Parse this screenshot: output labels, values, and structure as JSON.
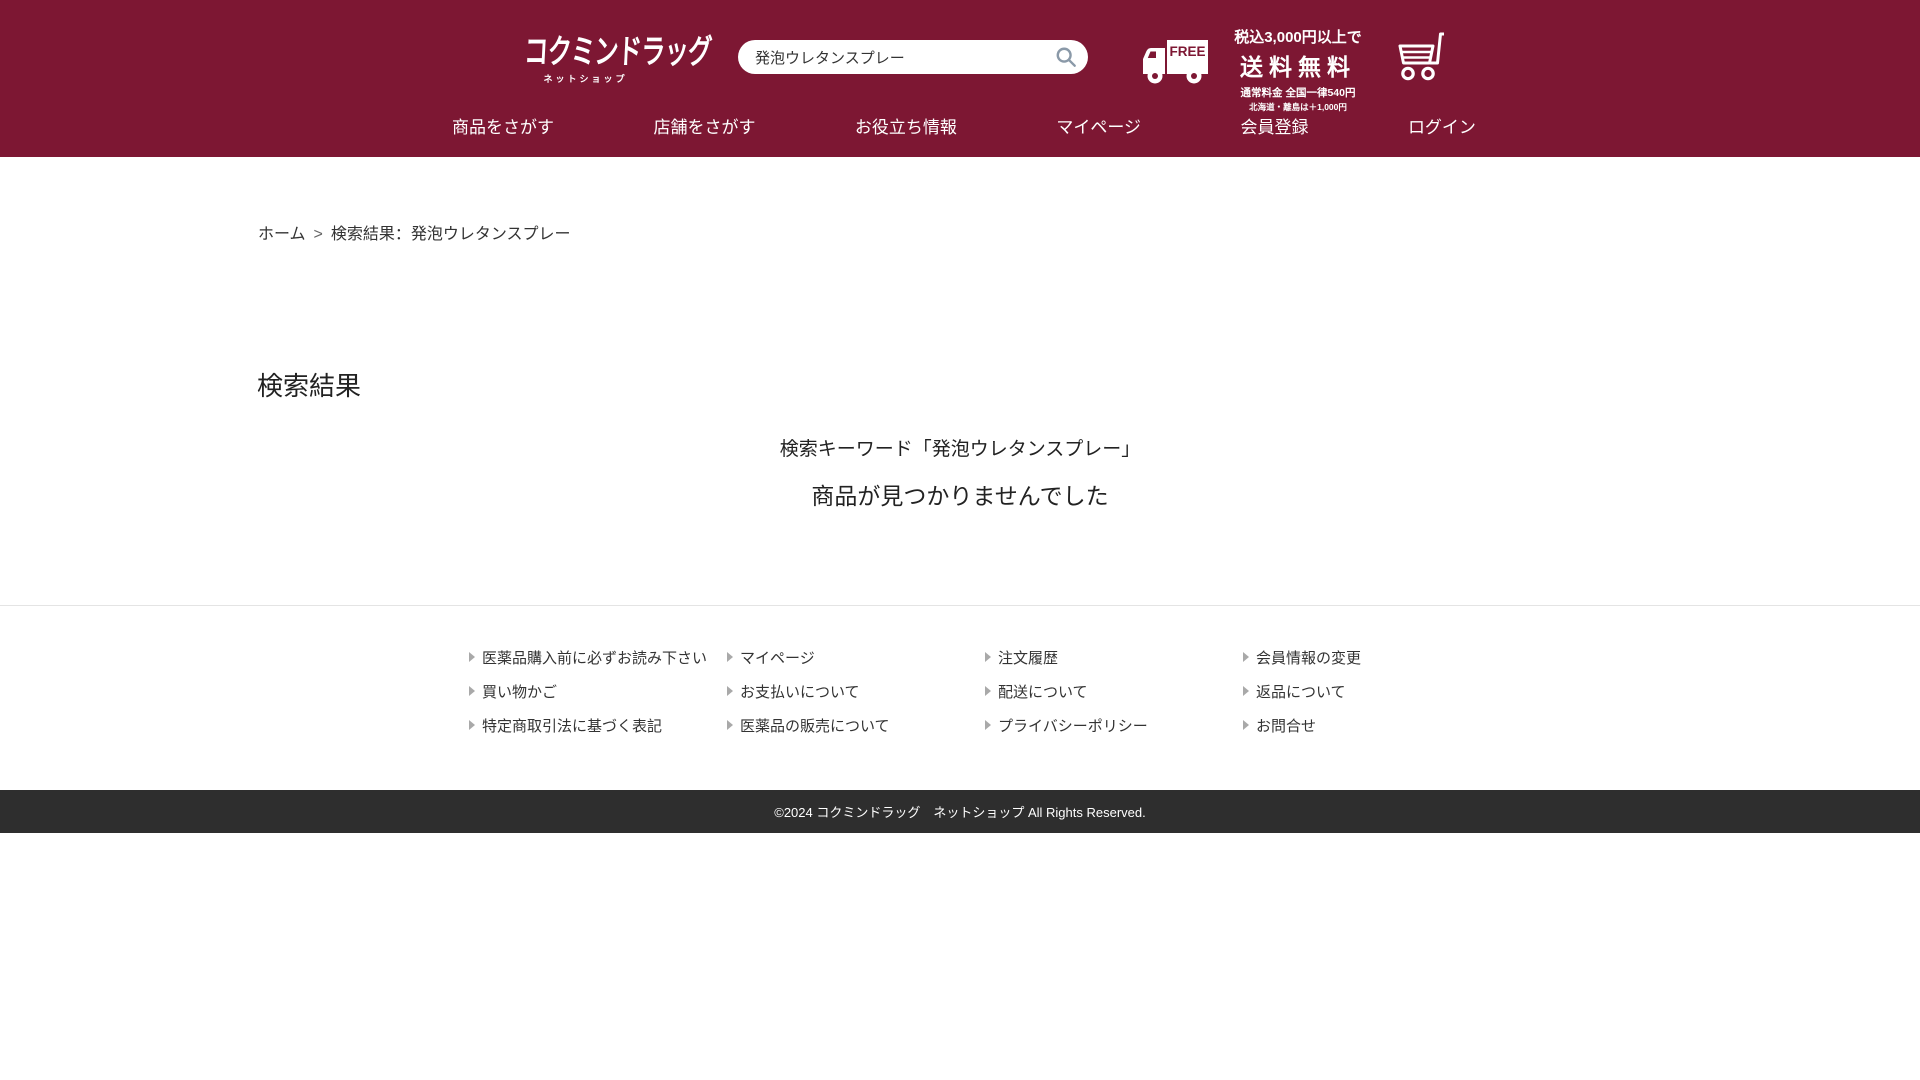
{
  "brand": {
    "logo_text": "コクミンドラッグ",
    "logo_subtitle": "ネットショップ"
  },
  "header": {
    "search_value": "発泡ウレタンスプレー",
    "shipping": {
      "free_badge": "FREE",
      "line1": "税込3,000円以上で",
      "line2": "送料無料",
      "line3": "通常料金 全国一律540円",
      "line4": "北海道・離島は＋1,000円"
    },
    "nav": [
      {
        "label": "商品をさがす"
      },
      {
        "label": "店舗をさがす"
      },
      {
        "label": "お役立ち情報"
      },
      {
        "label": "マイページ"
      },
      {
        "label": "会員登録"
      },
      {
        "label": "ログイン"
      }
    ]
  },
  "breadcrumb": {
    "home": "ホーム",
    "separator": ">",
    "current": "検索結果：発泡ウレタンスプレー"
  },
  "main": {
    "title": "検索結果",
    "keyword_line": "検索キーワード「発泡ウレタンスプレー」",
    "no_results": "商品が見つかりませんでした"
  },
  "footer": {
    "columns": [
      {
        "links": [
          {
            "label": "医薬品購入前に必ずお読み下さい"
          },
          {
            "label": "買い物かご"
          },
          {
            "label": "特定商取引法に基づく表記"
          }
        ]
      },
      {
        "links": [
          {
            "label": "マイページ"
          },
          {
            "label": "お支払いについて"
          },
          {
            "label": "医薬品の販売について"
          }
        ]
      },
      {
        "links": [
          {
            "label": "注文履歴"
          },
          {
            "label": "配送について"
          },
          {
            "label": "プライバシーポリシー"
          }
        ]
      },
      {
        "links": [
          {
            "label": "会員情報の変更"
          },
          {
            "label": "返品について"
          },
          {
            "label": "お問合せ"
          }
        ]
      }
    ],
    "copyright": "©2024 コクミンドラッグ　ネットショップ All Rights Reserved."
  },
  "colors": {
    "brand_maroon": "#7d1733",
    "copyright_bar": "#2e2e2e"
  }
}
